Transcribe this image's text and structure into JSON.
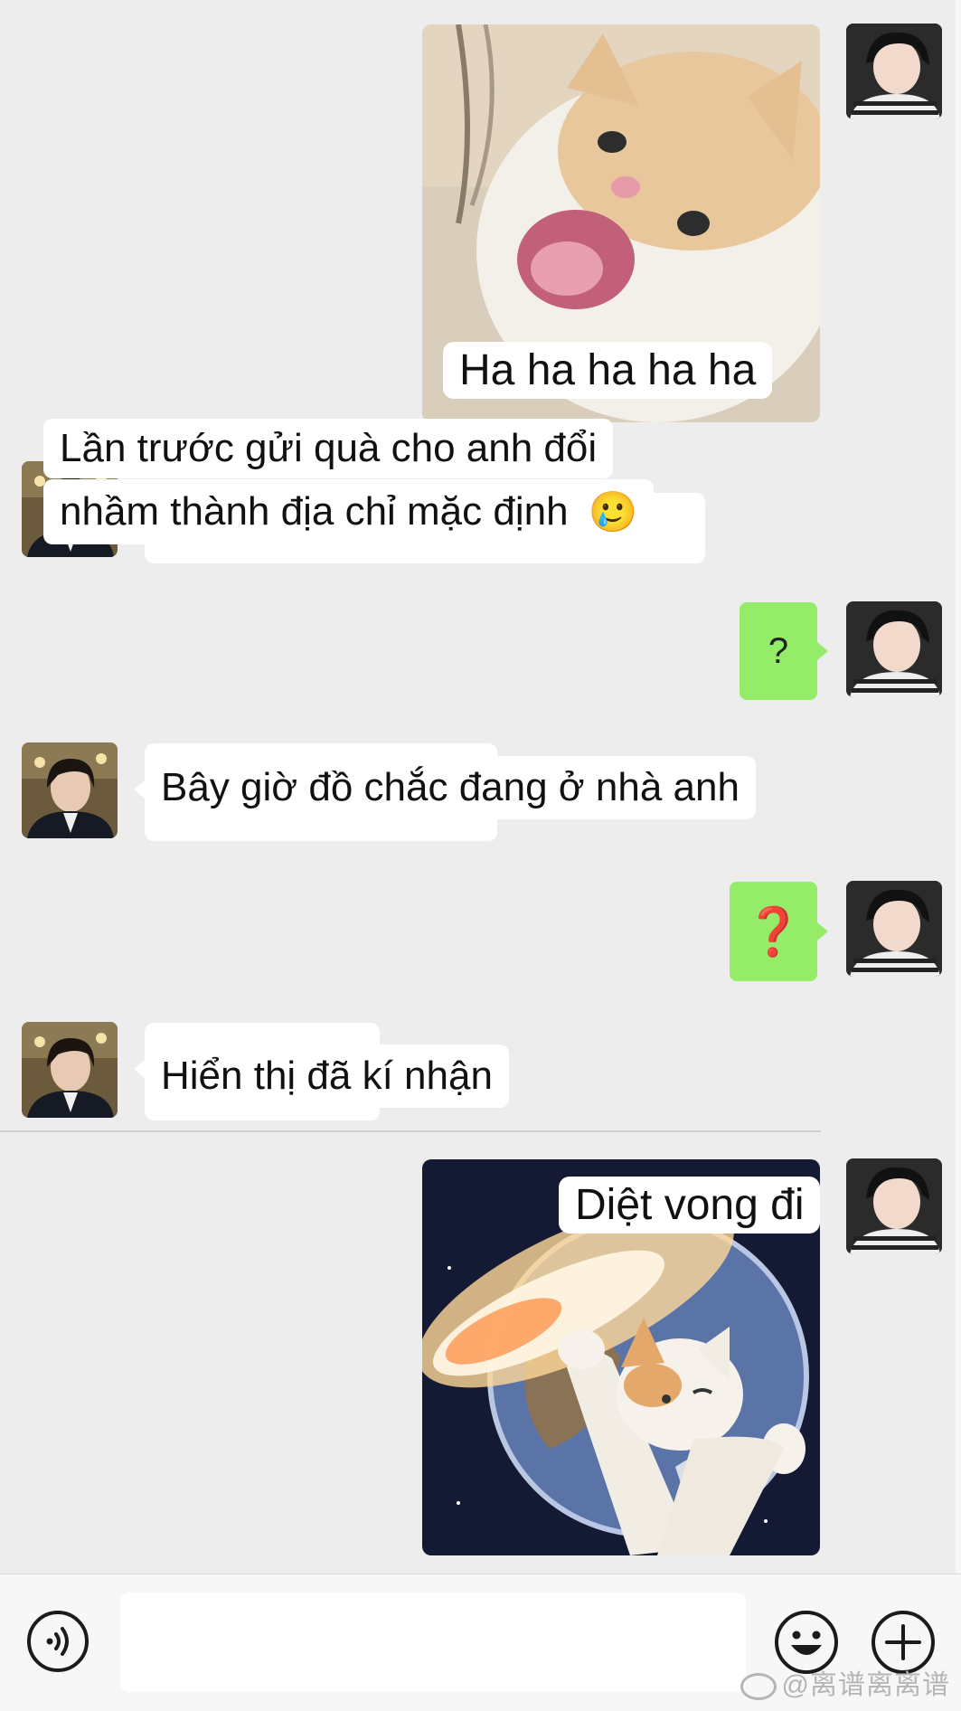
{
  "messages": {
    "m1_caption": "Ha ha ha ha ha",
    "m2_line1": "Lần trước gửi quà cho anh đổi",
    "m2_line2": "nhầm thành địa chỉ mặc định",
    "m2_emoji": "🥲",
    "m3_text": "?",
    "m4_text": "Bây giờ đồ chắc đang ở nhà anh",
    "m5_text": "❓",
    "m6_text": "Hiển thị đã kí nhận",
    "m7_caption": "Diệt vong đi"
  },
  "watermark": "@离谱离离谱",
  "icons": {
    "voice": "voice-icon",
    "emoji": "emoji-smile-icon",
    "plus": "plus-circle-icon",
    "weibo": "weibo-icon"
  },
  "colors": {
    "background": "#ededed",
    "sent_bubble": "#95ec69",
    "received_bubble": "#ffffff",
    "question_mark_red": "#d9242b"
  }
}
